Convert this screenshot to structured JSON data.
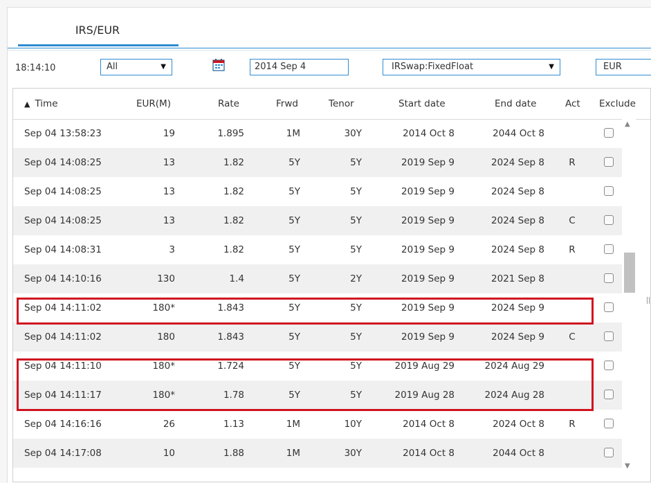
{
  "tab": {
    "label": "IRS/EUR"
  },
  "filters": {
    "time": "18:14:10",
    "scope_select": "All",
    "date": "2014 Sep 4",
    "instrument_select": "IRSwap:FixedFloat",
    "currency": "EUR"
  },
  "icons": {
    "calendar": "calendar-icon",
    "sort": "sort-ascending-icon"
  },
  "colors": {
    "accent": "#2e8bd0",
    "highlight": "#d0121f",
    "row_alt": "#f0f0f0"
  },
  "columns": [
    "Time",
    "EUR(M)",
    "Rate",
    "Frwd",
    "Tenor",
    "Start date",
    "End date",
    "Act",
    "Exclude"
  ],
  "rows": [
    {
      "time": "Sep 04 13:58:23",
      "eur": "19",
      "rate": "1.895",
      "frwd": "1M",
      "tenor": "30Y",
      "start": "2014 Oct 8",
      "end": "2044 Oct 8",
      "act": ""
    },
    {
      "time": "Sep 04 14:08:25",
      "eur": "13",
      "rate": "1.82",
      "frwd": "5Y",
      "tenor": "5Y",
      "start": "2019 Sep 9",
      "end": "2024 Sep 8",
      "act": "R"
    },
    {
      "time": "Sep 04 14:08:25",
      "eur": "13",
      "rate": "1.82",
      "frwd": "5Y",
      "tenor": "5Y",
      "start": "2019 Sep 9",
      "end": "2024 Sep 8",
      "act": ""
    },
    {
      "time": "Sep 04 14:08:25",
      "eur": "13",
      "rate": "1.82",
      "frwd": "5Y",
      "tenor": "5Y",
      "start": "2019 Sep 9",
      "end": "2024 Sep 8",
      "act": "C"
    },
    {
      "time": "Sep 04 14:08:31",
      "eur": "3",
      "rate": "1.82",
      "frwd": "5Y",
      "tenor": "5Y",
      "start": "2019 Sep 9",
      "end": "2024 Sep 8",
      "act": "R"
    },
    {
      "time": "Sep 04 14:10:16",
      "eur": "130",
      "rate": "1.4",
      "frwd": "5Y",
      "tenor": "2Y",
      "start": "2019 Sep 9",
      "end": "2021 Sep 8",
      "act": ""
    },
    {
      "time": "Sep 04 14:11:02",
      "eur": "180*",
      "rate": "1.843",
      "frwd": "5Y",
      "tenor": "5Y",
      "start": "2019 Sep 9",
      "end": "2024 Sep 9",
      "act": ""
    },
    {
      "time": "Sep 04 14:11:02",
      "eur": "180",
      "rate": "1.843",
      "frwd": "5Y",
      "tenor": "5Y",
      "start": "2019 Sep 9",
      "end": "2024 Sep 9",
      "act": "C"
    },
    {
      "time": "Sep 04 14:11:10",
      "eur": "180*",
      "rate": "1.724",
      "frwd": "5Y",
      "tenor": "5Y",
      "start": "2019 Aug 29",
      "end": "2024 Aug 29",
      "act": ""
    },
    {
      "time": "Sep 04 14:11:17",
      "eur": "180*",
      "rate": "1.78",
      "frwd": "5Y",
      "tenor": "5Y",
      "start": "2019 Aug 28",
      "end": "2024 Aug 28",
      "act": ""
    },
    {
      "time": "Sep 04 14:16:16",
      "eur": "26",
      "rate": "1.13",
      "frwd": "1M",
      "tenor": "10Y",
      "start": "2014 Oct 8",
      "end": "2024 Oct 8",
      "act": "R"
    },
    {
      "time": "Sep 04 14:17:08",
      "eur": "10",
      "rate": "1.88",
      "frwd": "1M",
      "tenor": "30Y",
      "start": "2014 Oct 8",
      "end": "2044 Oct 8",
      "act": ""
    }
  ]
}
